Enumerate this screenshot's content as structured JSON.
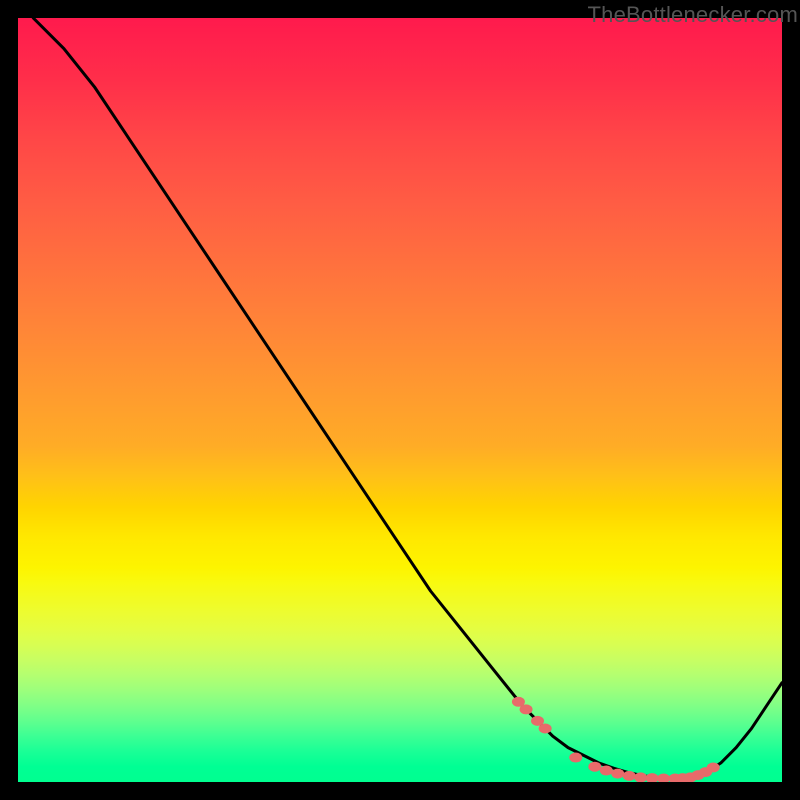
{
  "watermark": "TheBottlenecker.com",
  "chart_data": {
    "type": "line",
    "title": "",
    "xlabel": "",
    "ylabel": "",
    "xlim": [
      0,
      100
    ],
    "ylim": [
      0,
      100
    ],
    "x": [
      2,
      6,
      10,
      14,
      18,
      22,
      26,
      30,
      34,
      38,
      42,
      46,
      50,
      54,
      58,
      62,
      66,
      70,
      72,
      74,
      76,
      78,
      80,
      82,
      84,
      86,
      88,
      90,
      92,
      94,
      96,
      98,
      100
    ],
    "values": [
      100,
      96,
      91,
      85,
      79,
      73,
      67,
      61,
      55,
      49,
      43,
      37,
      31,
      25,
      20,
      15,
      10,
      6,
      4.5,
      3.5,
      2.5,
      1.8,
      1.2,
      0.8,
      0.5,
      0.4,
      0.5,
      1.2,
      2.5,
      4.5,
      7,
      10,
      13
    ],
    "markers": {
      "x": [
        65.5,
        66.5,
        68,
        69,
        73,
        75.5,
        77,
        78.5,
        80,
        81.5,
        83,
        84.5,
        86,
        87,
        88,
        89,
        90,
        91
      ],
      "y": [
        10.5,
        9.5,
        8,
        7,
        3.2,
        2,
        1.5,
        1.1,
        0.8,
        0.6,
        0.5,
        0.45,
        0.45,
        0.5,
        0.6,
        0.9,
        1.3,
        1.9
      ]
    },
    "colors": {
      "line": "#000000",
      "marker": "#e86a6a"
    }
  }
}
